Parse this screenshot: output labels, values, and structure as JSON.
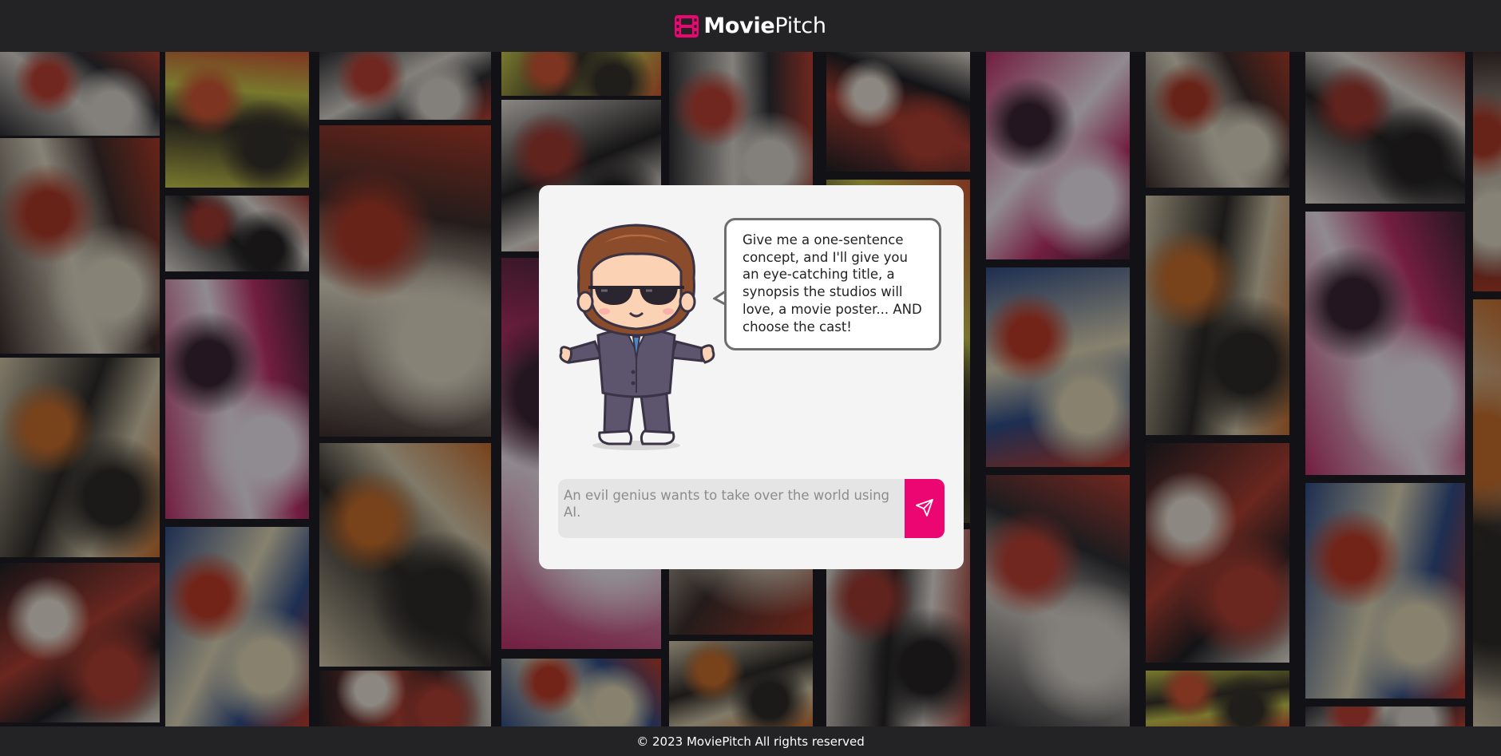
{
  "header": {
    "brand_bold": "Movie",
    "brand_light": "Pitch",
    "logo_icon": "film-icon",
    "accent_color": "#ec0672"
  },
  "card": {
    "mascot_icon": "mascot-icon",
    "speech": "Give me a one-sentence concept, and I'll give you an eye-catching title, a synopsis the studios will love, a movie poster... AND choose the cast!",
    "input": {
      "placeholder": "An evil genius wants to take over the world using AI.",
      "value": ""
    },
    "send_icon": "send-icon"
  },
  "background": {
    "description_icon": "poster-collage"
  },
  "footer": {
    "text": "© 2023 MoviePitch All rights reserved"
  }
}
